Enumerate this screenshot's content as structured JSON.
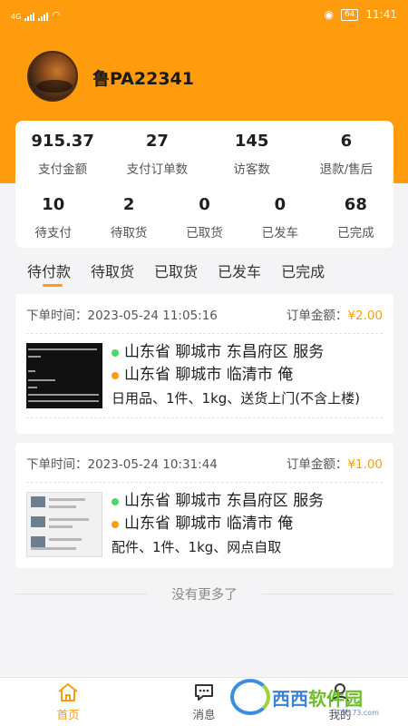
{
  "status_bar": {
    "network": "4G",
    "battery": "64",
    "time": "11:41"
  },
  "profile": {
    "plate": "鲁PA22341"
  },
  "stats_top": [
    {
      "value": "915.37",
      "label": "支付金额"
    },
    {
      "value": "27",
      "label": "支付订单数"
    },
    {
      "value": "145",
      "label": "访客数"
    },
    {
      "value": "6",
      "label": "退款/售后"
    }
  ],
  "stats_bottom": [
    {
      "value": "10",
      "label": "待支付"
    },
    {
      "value": "2",
      "label": "待取货"
    },
    {
      "value": "0",
      "label": "已取货"
    },
    {
      "value": "0",
      "label": "已发车"
    },
    {
      "value": "68",
      "label": "已完成"
    }
  ],
  "tabs": [
    {
      "label": "待付款",
      "active": true
    },
    {
      "label": "待取货"
    },
    {
      "label": "已取货"
    },
    {
      "label": "已发车"
    },
    {
      "label": "已完成"
    }
  ],
  "orders": [
    {
      "time_label": "下单时间：",
      "time": "2023-05-24 11:05:16",
      "amount_label": "订单金额：",
      "amount": "¥2.00",
      "from": "山东省 聊城市 东昌府区 服务",
      "to": "山东省 聊城市 临清市 俺",
      "goods": "日用品、1件、1kg、送货上门(不含上楼)"
    },
    {
      "time_label": "下单时间：",
      "time": "2023-05-24 10:31:44",
      "amount_label": "订单金额：",
      "amount": "¥1.00",
      "from": "山东省 聊城市 东昌府区 服务",
      "to": "山东省 聊城市 临清市 俺",
      "goods": "配件、1件、1kg、网点自取"
    }
  ],
  "no_more": "没有更多了",
  "tabbar": [
    {
      "label": "首页",
      "icon": "home-icon",
      "active": true
    },
    {
      "label": "消息",
      "icon": "message-icon"
    },
    {
      "label": "我的",
      "icon": "user-icon"
    }
  ],
  "watermark": {
    "text_a": "西西",
    "text_b": "软件园",
    "sub": "CR173.com"
  },
  "colors": {
    "accent": "#ff9c0d",
    "green": "#4cd964"
  }
}
